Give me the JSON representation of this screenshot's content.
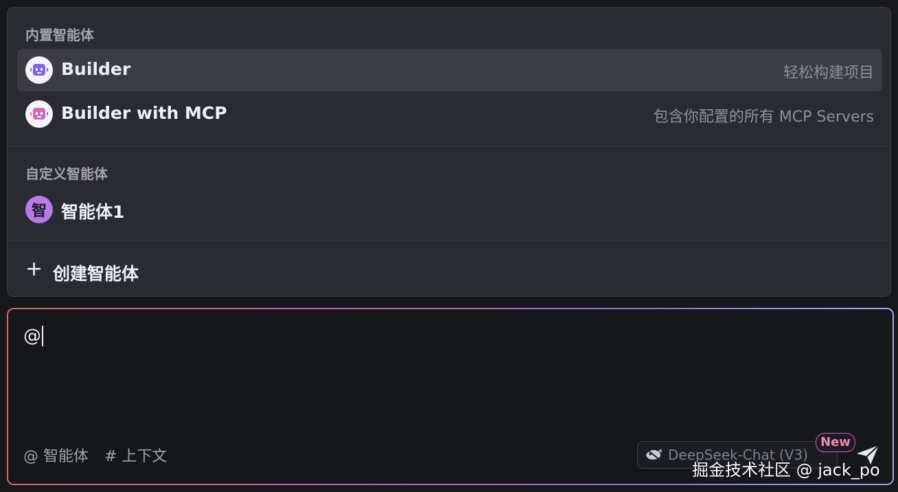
{
  "dropdown": {
    "builtin_title": "内置智能体",
    "builtin_items": [
      {
        "label": "Builder",
        "description": "轻松构建项目",
        "icon": "robot-icon"
      },
      {
        "label": "Builder with MCP",
        "description": "包含你配置的所有 MCP Servers",
        "icon": "robot-mcp-icon"
      }
    ],
    "custom_title": "自定义智能体",
    "custom_items": [
      {
        "label": "智能体1",
        "avatar_text": "智"
      }
    ],
    "create_label": "创建智能体",
    "create_icon": "+"
  },
  "input": {
    "value": "@",
    "mention_chip": "@ 智能体",
    "context_chip": "# 上下文",
    "model_name": "DeepSeek-Chat (V3)",
    "new_badge": "New",
    "send_icon": "send-icon"
  },
  "watermark": "掘金技术社区 @ jack_po",
  "colors": {
    "accent_purple": "#b67be6",
    "border_gradient_start": "#e0626a",
    "border_gradient_end": "#9fa6e8",
    "badge_pink": "#ef8ab0"
  }
}
